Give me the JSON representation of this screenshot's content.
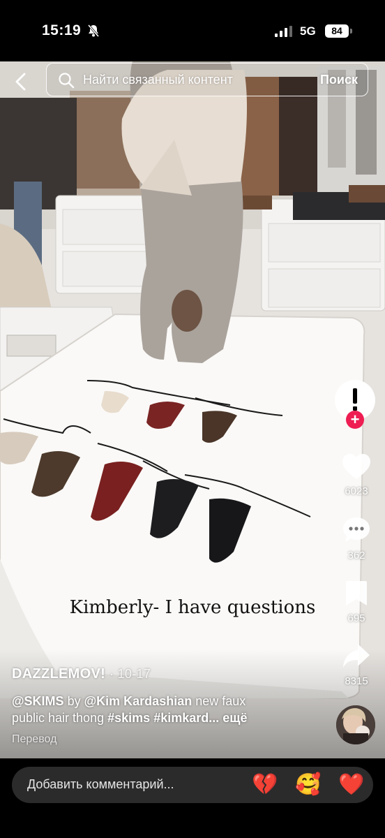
{
  "status_bar": {
    "time": "15:19",
    "network": "5G",
    "battery": "84"
  },
  "search": {
    "placeholder": "Найти связанный контент",
    "button_label": "Поиск"
  },
  "video": {
    "caption_overlay": "Kimberly- I have questions"
  },
  "actions": {
    "like_count": "6023",
    "comment_count": "362",
    "save_count": "695",
    "share_count": "8315"
  },
  "post": {
    "author": "DAZZLEMOV!",
    "date": "· 10-17",
    "mention": "@SKIMS",
    "by_word": "by",
    "creator": "@Kim Kardashian",
    "text_1": "new faux",
    "text_2": "public hair thong",
    "hashtag_1": "#skims",
    "hashtag_2": "#kimkard...",
    "more_label": "ещё",
    "translate_label": "Перевод"
  },
  "comment_bar": {
    "placeholder": "Добавить комментарий...",
    "emojis": [
      "💔",
      "🥰",
      "❤️"
    ]
  },
  "colors": {
    "accent": "#ee1d52",
    "bar_bg": "#2b2b2b"
  }
}
